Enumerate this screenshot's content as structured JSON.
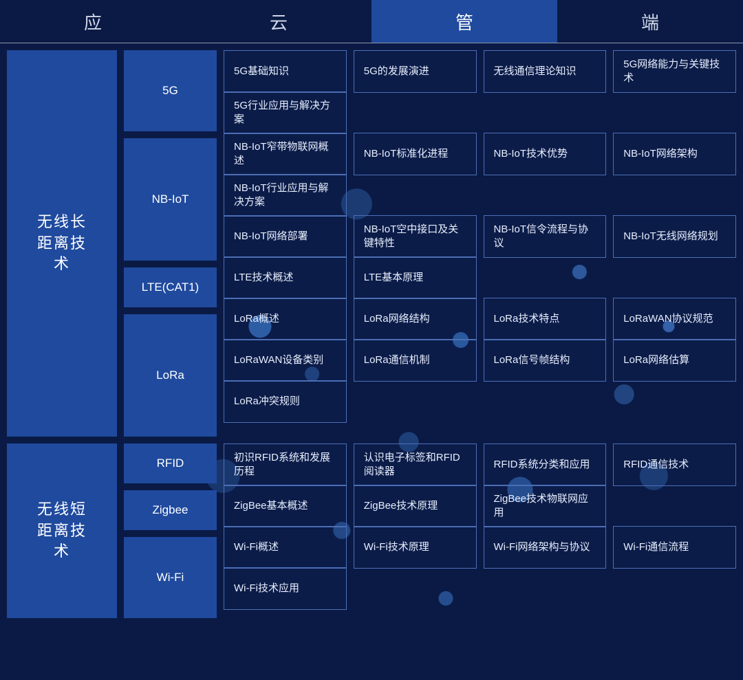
{
  "tabs": [
    {
      "label": "应",
      "active": false
    },
    {
      "label": "云",
      "active": false
    },
    {
      "label": "管",
      "active": true
    },
    {
      "label": "端",
      "active": false
    }
  ],
  "sections": [
    {
      "category": "无线长距离技术",
      "groups": [
        {
          "sub": "5G",
          "rows": [
            [
              "5G基础知识",
              "5G的发展演进",
              "无线通信理论知识",
              "5G网络能力与关键技术"
            ],
            [
              "5G行业应用与解决方案",
              "",
              "",
              ""
            ]
          ]
        },
        {
          "sub": "NB-IoT",
          "rows": [
            [
              "NB-IoT窄带物联网概述",
              "NB-IoT标准化进程",
              "NB-IoT技术优势",
              "NB-IoT网络架构"
            ],
            [
              "NB-IoT行业应用与解决方案",
              "",
              "",
              ""
            ],
            [
              "NB-IoT网络部署",
              "NB-IoT空中接口及关键特性",
              "NB-IoT信令流程与协议",
              "NB-IoT无线网络规划"
            ]
          ]
        },
        {
          "sub": "LTE(CAT1)",
          "rows": [
            [
              "LTE技术概述",
              "LTE基本原理",
              "",
              ""
            ]
          ]
        },
        {
          "sub": "LoRa",
          "rows": [
            [
              "LoRa概述",
              "LoRa网络结构",
              "LoRa技术特点",
              "LoRaWAN协议规范"
            ],
            [
              "LoRaWAN设备类别",
              "LoRa通信机制",
              "LoRa信号帧结构",
              "LoRa网络估算"
            ],
            [
              "LoRa冲突规则",
              "",
              "",
              ""
            ]
          ]
        }
      ]
    },
    {
      "category": "无线短距离技术",
      "groups": [
        {
          "sub": "RFID",
          "rows": [
            [
              "初识RFID系统和发展历程",
              "认识电子标签和RFID阅读器",
              "RFID系统分类和应用",
              "RFID通信技术"
            ]
          ]
        },
        {
          "sub": "Zigbee",
          "rows": [
            [
              "ZigBee基本概述",
              "ZigBee技术原理",
              "ZigBee技术物联网应用",
              ""
            ]
          ]
        },
        {
          "sub": "Wi-Fi",
          "rows": [
            [
              "Wi-Fi概述",
              "Wi-Fi技术原理",
              "Wi-Fi网络架构与协议",
              "Wi-Fi通信流程"
            ],
            [
              "Wi-Fi技术应用",
              "",
              "",
              ""
            ]
          ]
        }
      ]
    }
  ]
}
